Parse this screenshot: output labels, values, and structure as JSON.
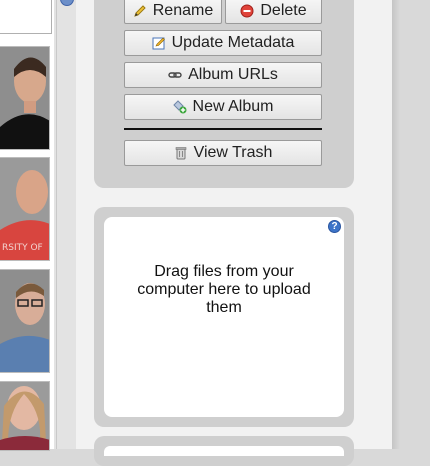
{
  "album_actions": {
    "rename_label": "Rename",
    "delete_label": "Delete",
    "update_metadata_label": "Update Metadata",
    "album_urls_label": "Album URLs",
    "new_album_label": "New Album",
    "view_trash_label": "View Trash"
  },
  "upload": {
    "dropzone_text": "Drag files from your computer here to upload them",
    "help_icon_label": "?"
  },
  "thumbnails": [
    {
      "alt": "person-photo-1"
    },
    {
      "alt": "person-photo-2"
    },
    {
      "alt": "person-photo-3"
    },
    {
      "alt": "person-photo-4"
    }
  ]
}
